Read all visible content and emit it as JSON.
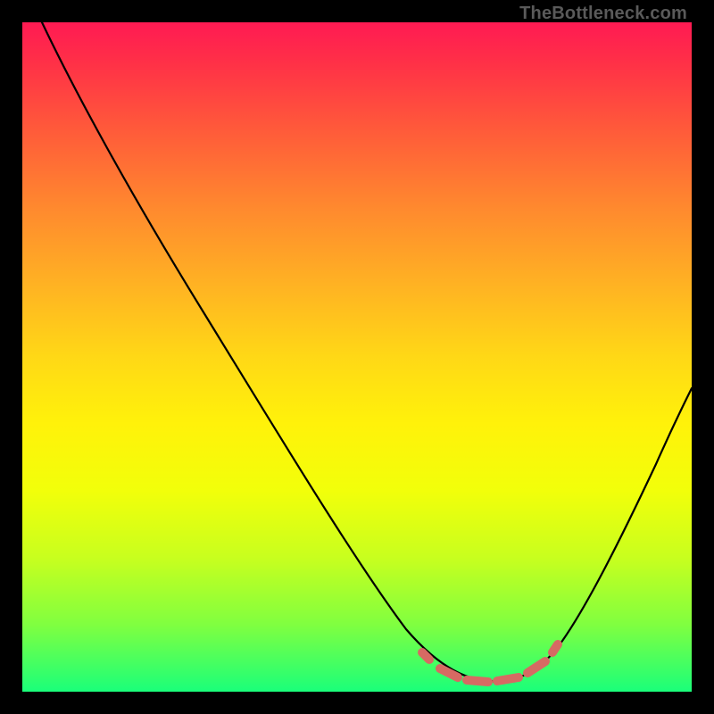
{
  "watermark": "TheBottleneck.com",
  "colors": {
    "gradient_top": "#ff1a53",
    "gradient_bottom": "#1aff7a",
    "curve": "#000000",
    "dash": "#d66a63",
    "frame": "#000000"
  },
  "chart_data": {
    "type": "line",
    "title": "",
    "xlabel": "",
    "ylabel": "",
    "xlim": [
      0,
      100
    ],
    "ylim": [
      0,
      100
    ],
    "grid": false,
    "legend": false,
    "series": [
      {
        "name": "bottleneck-curve",
        "x": [
          3,
          10,
          20,
          30,
          40,
          50,
          56,
          60,
          64,
          68,
          72,
          76,
          80,
          86,
          92,
          100
        ],
        "y": [
          100,
          88,
          72,
          56,
          40,
          24,
          14,
          8,
          3,
          1.3,
          1,
          1.3,
          3,
          10,
          22,
          42
        ]
      }
    ],
    "highlight_dashes": {
      "description": "salmon dashed segment near valley bottom",
      "x_range": [
        60,
        80
      ],
      "y_approx": 1.5
    }
  }
}
